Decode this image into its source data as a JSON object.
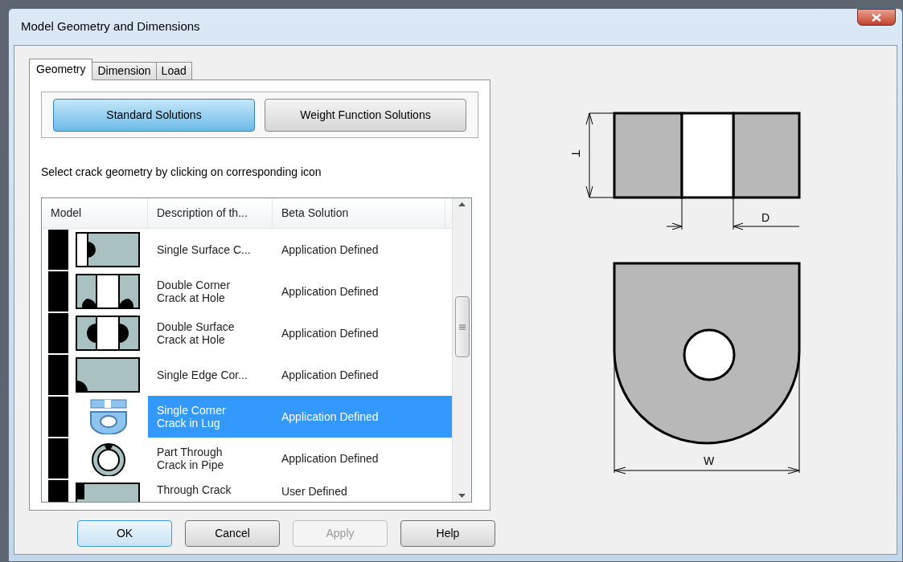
{
  "window": {
    "title": "Model Geometry and Dimensions"
  },
  "tabs": [
    {
      "label": "Geometry",
      "selected": true
    },
    {
      "label": "Dimension",
      "selected": false
    },
    {
      "label": "Load",
      "selected": false
    }
  ],
  "solution_buttons": [
    {
      "label": "Standard Solutions",
      "selected": true
    },
    {
      "label": "Weight Function Solutions",
      "selected": false
    }
  ],
  "instruction": "Select  crack geometry by clicking  on corresponding icon",
  "table": {
    "columns": [
      "Model",
      "Description of th...",
      "Beta Solution"
    ],
    "rows": [
      {
        "kind": "surface-plate",
        "description": "Single Surface C...",
        "beta": "Application Defined",
        "selected": false
      },
      {
        "kind": "double-corner-hole",
        "description": "Double Corner\nCrack at Hole",
        "beta": "Application Defined",
        "selected": false
      },
      {
        "kind": "double-surface-hole",
        "description": "Double Surface\nCrack at Hole",
        "beta": "Application Defined",
        "selected": false
      },
      {
        "kind": "edge-corner",
        "description": "Single Edge Cor...",
        "beta": "Application Defined",
        "selected": false
      },
      {
        "kind": "lug",
        "description": "Single Corner\nCrack in Lug",
        "beta": "Application Defined",
        "selected": true
      },
      {
        "kind": "pipe",
        "description": "Part Through\nCrack in Pipe",
        "beta": "Application Defined",
        "selected": false
      },
      {
        "kind": "through-plate",
        "description": "Through Crack",
        "beta": "User Defined",
        "selected": false
      }
    ]
  },
  "diagram": {
    "labels": [
      "T",
      "D",
      "W"
    ]
  },
  "buttons": [
    {
      "label": "OK",
      "default": true,
      "disabled": false
    },
    {
      "label": "Cancel",
      "default": false,
      "disabled": false
    },
    {
      "label": "Apply",
      "default": false,
      "disabled": true
    },
    {
      "label": "Help",
      "default": false,
      "disabled": false
    }
  ]
}
